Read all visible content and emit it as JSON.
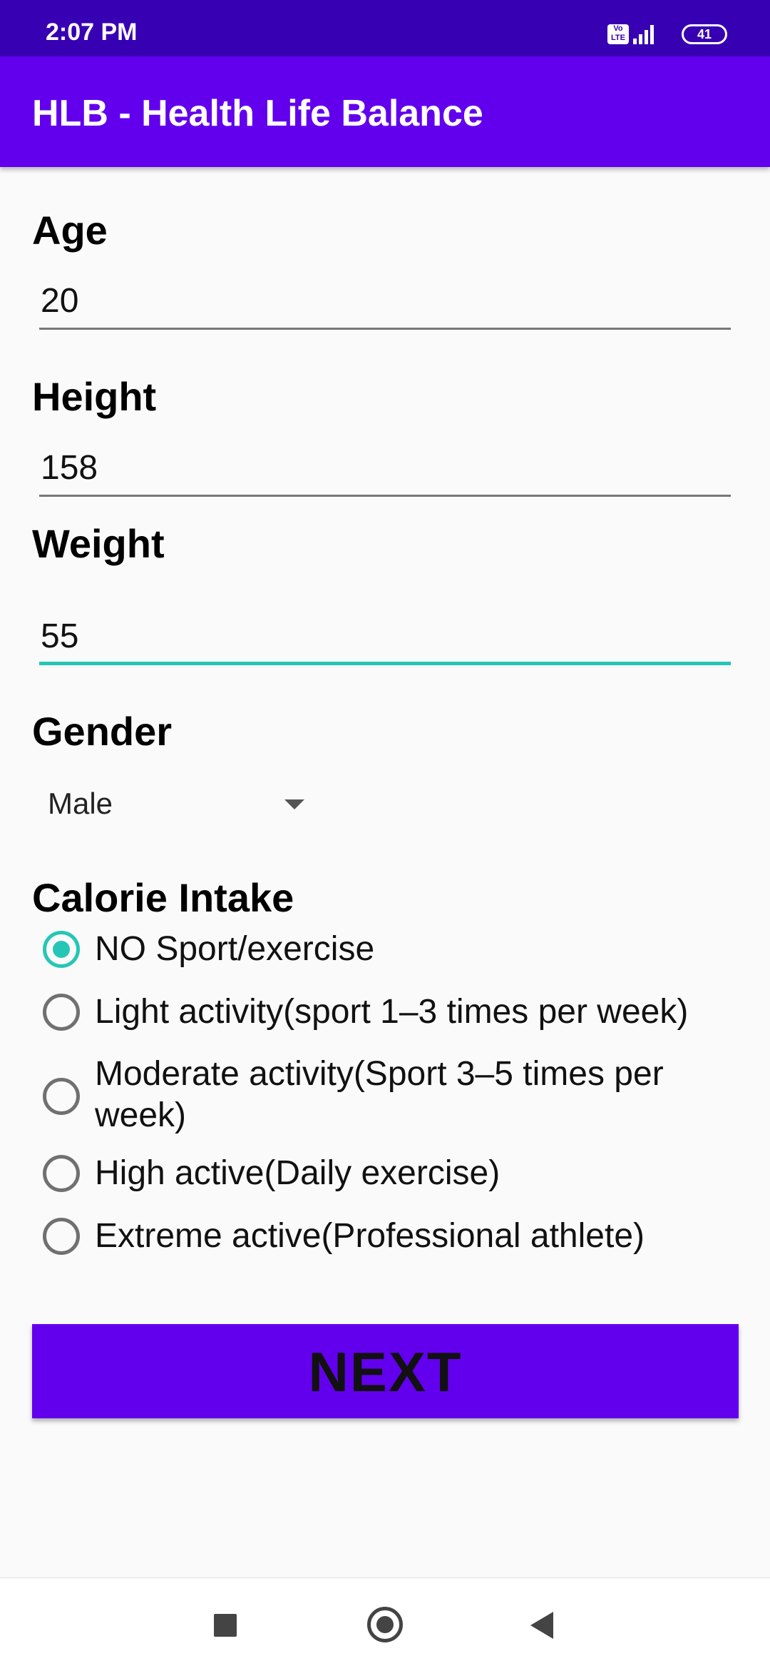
{
  "status_bar": {
    "time": "2:07 PM",
    "volte_text": "Vo LTE",
    "battery": "41",
    "icons": [
      "volte-icon",
      "signal-icon",
      "battery-icon"
    ]
  },
  "app_bar": {
    "title": "HLB - Health Life Balance"
  },
  "form": {
    "age": {
      "label": "Age",
      "value": "20"
    },
    "height": {
      "label": "Height",
      "value": "158"
    },
    "weight": {
      "label": "Weight",
      "value": "55"
    },
    "gender": {
      "label": "Gender",
      "selected": "Male"
    },
    "calorie": {
      "label": "Calorie Intake",
      "selected_index": 0,
      "options": [
        "NO Sport/exercise",
        "Light activity(sport 1–3 times per week)",
        "Moderate activity(Sport 3–5 times per week)",
        "High active(Daily exercise)",
        "Extreme active(Professional athlete)"
      ]
    }
  },
  "next_button": {
    "label": "NEXT"
  },
  "nav_bar": {
    "icons": [
      "recents-icon",
      "home-icon",
      "back-icon"
    ]
  },
  "colors": {
    "primary": "#6200ee",
    "primary_dark": "#3700b3",
    "accent": "#26c6b6"
  }
}
